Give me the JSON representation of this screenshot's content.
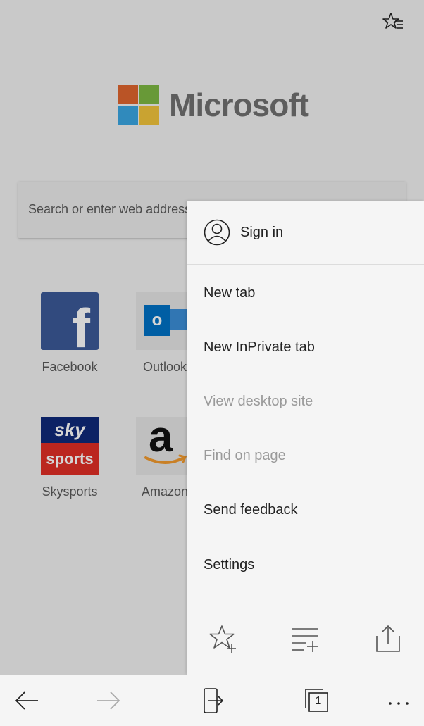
{
  "colors": {
    "ms_red": "#e0662e",
    "ms_green": "#7eb843",
    "ms_blue": "#3aa7e2",
    "ms_yellow": "#f2c43c",
    "facebook": "#3b5998",
    "outlook": "#0072c6",
    "sky_blue": "#0f2a7a",
    "sky_red": "#e12e26",
    "amazon_orange": "#f29a2e"
  },
  "header": {
    "favorites_icon": "favorites-list-icon"
  },
  "logo": {
    "text": "Microsoft"
  },
  "search": {
    "placeholder": "Search or enter web address"
  },
  "tiles": [
    {
      "label": "Facebook",
      "glyph": "f"
    },
    {
      "label": "Outlook",
      "glyph": "o"
    },
    {
      "label": "Skysports",
      "line1": "sky",
      "line2": "sports"
    },
    {
      "label": "Amazon",
      "glyph": "a"
    }
  ],
  "menu": {
    "sign_in": "Sign in",
    "items": [
      {
        "label": "New tab",
        "enabled": true
      },
      {
        "label": "New InPrivate tab",
        "enabled": true
      },
      {
        "label": "View desktop site",
        "enabled": false
      },
      {
        "label": "Find on page",
        "enabled": false
      },
      {
        "label": "Send feedback",
        "enabled": true
      },
      {
        "label": "Settings",
        "enabled": true
      }
    ],
    "actions": [
      "add-favorite-icon",
      "add-to-reading-list-icon",
      "share-icon"
    ]
  },
  "bottom_bar": {
    "tab_count": "1",
    "icons": [
      "back-arrow-icon",
      "forward-arrow-icon",
      "continue-on-pc-icon",
      "tabs-icon",
      "more-icon"
    ]
  }
}
